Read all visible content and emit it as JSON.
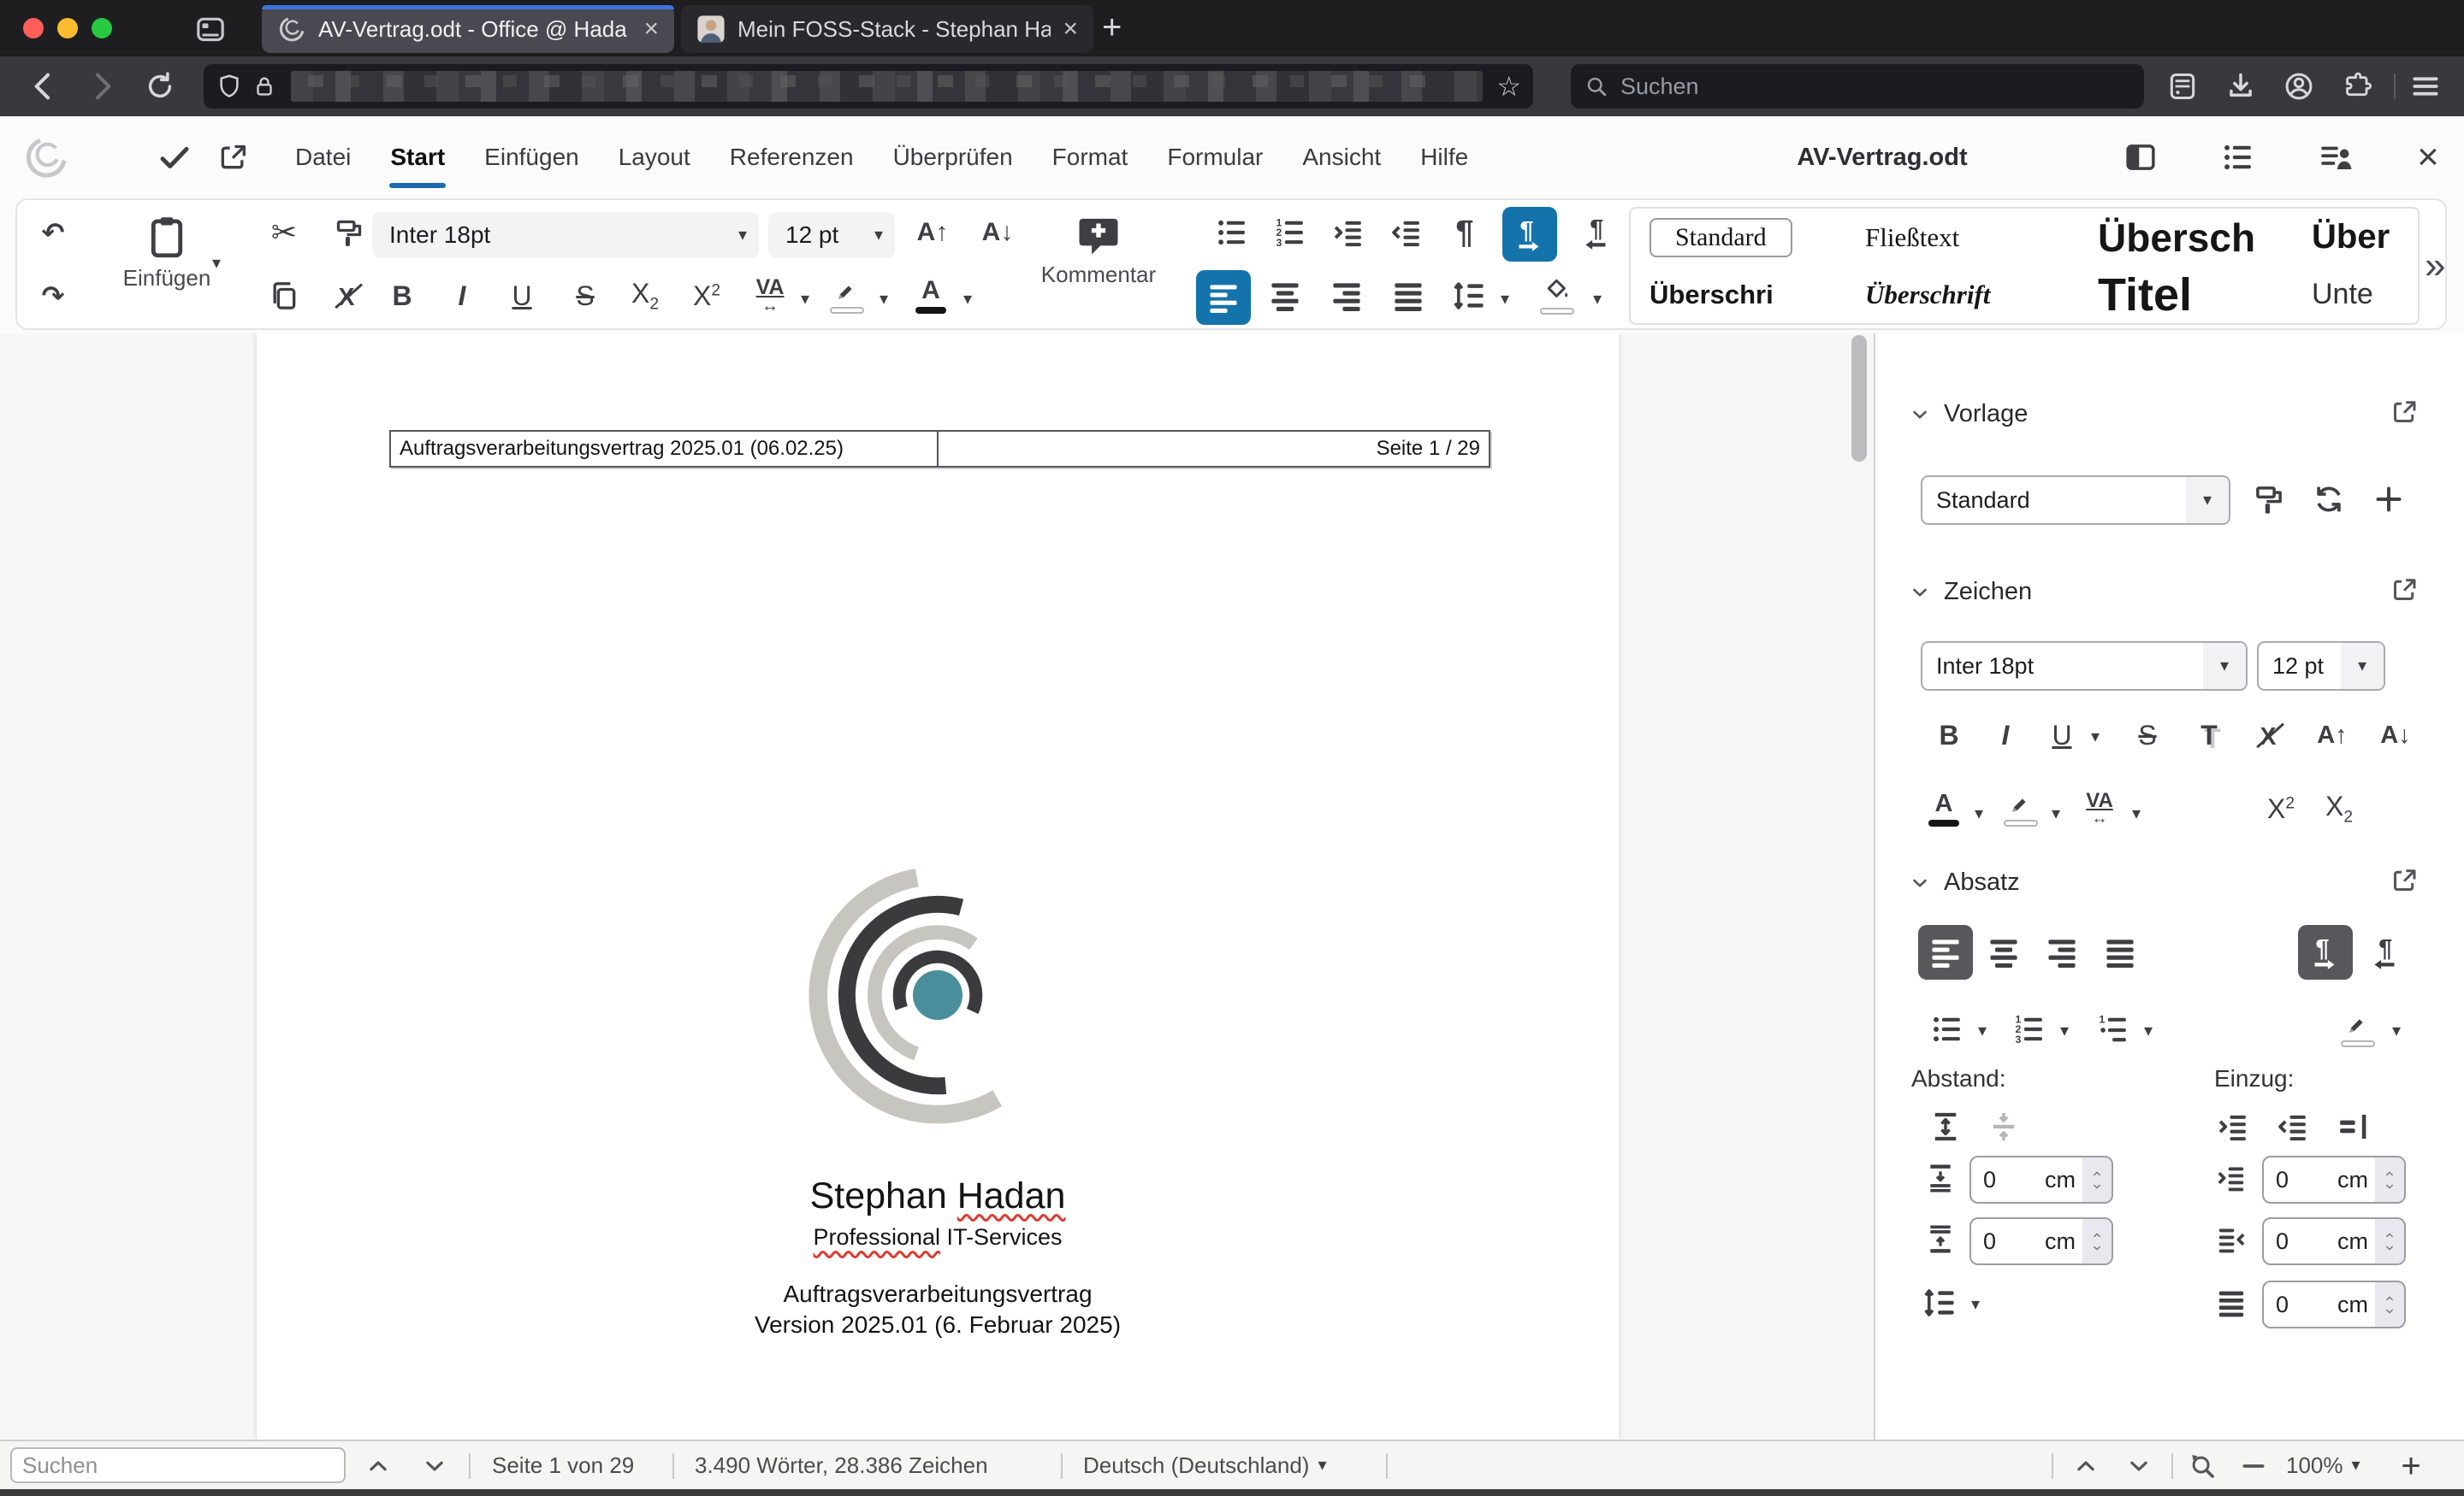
{
  "browser": {
    "tabs": [
      {
        "title": "AV-Vertrag.odt - Office @ Hada"
      },
      {
        "title": "Mein FOSS-Stack - Stephan Ha"
      }
    ],
    "search_placeholder": "Suchen"
  },
  "menubar": {
    "items": [
      "Datei",
      "Start",
      "Einfügen",
      "Layout",
      "Referenzen",
      "Überprüfen",
      "Format",
      "Formular",
      "Ansicht",
      "Hilfe"
    ],
    "active_item": "Start",
    "doc_title": "AV-Vertrag.odt"
  },
  "toolbar": {
    "paste_label": "Einfügen",
    "font_name": "Inter 18pt",
    "font_size": "12 pt",
    "comment_label": "Kommentar",
    "styles": [
      "Standard",
      "Fließtext",
      "Übersch",
      "Über",
      "Überschri",
      "Überschrift",
      "Titel",
      "Unte"
    ]
  },
  "sidebar": {
    "vorlage": {
      "title": "Vorlage",
      "style_value": "Standard"
    },
    "zeichen": {
      "title": "Zeichen",
      "font_name": "Inter 18pt",
      "font_size": "12 pt"
    },
    "absatz": {
      "title": "Absatz",
      "abstand_label": "Abstand:",
      "einzug_label": "Einzug:",
      "spacing_fields": [
        {
          "value": "0",
          "unit": "cm"
        },
        {
          "value": "0",
          "unit": "cm"
        }
      ],
      "indent_fields": [
        {
          "value": "0",
          "unit": "cm"
        },
        {
          "value": "0",
          "unit": "cm"
        },
        {
          "value": "0",
          "unit": "cm"
        }
      ]
    }
  },
  "document": {
    "header_left": "Auftragsverarbeitungsvertrag 2025.01 (06.02.25)",
    "header_right": "Seite 1 / 29",
    "name_first": "Stephan ",
    "name_last": "Hadan",
    "subtitle_first": "Professional",
    "subtitle_rest": " IT-Services",
    "line1": "Auftragsverarbeitungsvertrag",
    "line2": "Version 2025.01 (6. Februar 2025)"
  },
  "statusbar": {
    "search_placeholder": "Suchen",
    "page": "Seite 1 von 29",
    "words": "3.490 Wörter, 28.386 Zeichen",
    "language": "Deutsch (Deutschland)",
    "zoom": "100%"
  },
  "colors": {
    "accent_blue": "#1473ab",
    "firefox_tab_accent": "#3d74e0",
    "logo_dark": "#3b3b3d",
    "logo_gray": "#c7c5bf",
    "logo_teal": "#4a8e9b"
  }
}
